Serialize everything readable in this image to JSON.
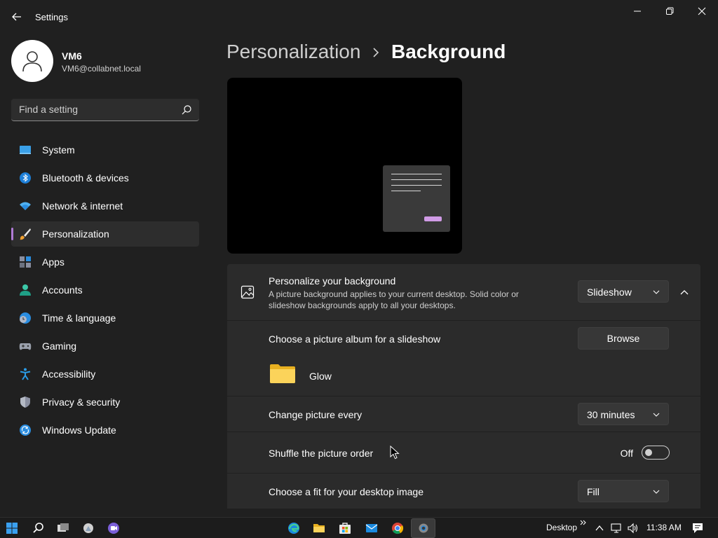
{
  "window": {
    "title": "Settings",
    "back_icon": "back-arrow-icon",
    "controls": [
      "minimize-icon",
      "restore-icon",
      "close-icon"
    ]
  },
  "profile": {
    "name": "VM6",
    "email": "VM6@collabnet.local"
  },
  "search": {
    "placeholder": "Find a setting"
  },
  "sidebar": {
    "items": [
      {
        "label": "System",
        "icon": "system-icon",
        "active": false
      },
      {
        "label": "Bluetooth & devices",
        "icon": "bluetooth-icon",
        "active": false
      },
      {
        "label": "Network & internet",
        "icon": "wifi-icon",
        "active": false
      },
      {
        "label": "Personalization",
        "icon": "brush-icon",
        "active": true
      },
      {
        "label": "Apps",
        "icon": "apps-icon",
        "active": false
      },
      {
        "label": "Accounts",
        "icon": "accounts-icon",
        "active": false
      },
      {
        "label": "Time & language",
        "icon": "clock-globe-icon",
        "active": false
      },
      {
        "label": "Gaming",
        "icon": "gamepad-icon",
        "active": false
      },
      {
        "label": "Accessibility",
        "icon": "accessibility-icon",
        "active": false
      },
      {
        "label": "Privacy & security",
        "icon": "shield-icon",
        "active": false
      },
      {
        "label": "Windows Update",
        "icon": "update-icon",
        "active": false
      }
    ]
  },
  "header": {
    "parent": "Personalization",
    "current": "Background"
  },
  "settings": {
    "personalize": {
      "title": "Personalize your background",
      "description": "A picture background applies to your current desktop. Solid color or slideshow backgrounds apply to all your desktops.",
      "value": "Slideshow"
    },
    "album": {
      "label": "Choose a picture album for a slideshow",
      "button": "Browse",
      "folder_name": "Glow"
    },
    "change": {
      "label": "Change picture every",
      "value": "30 minutes"
    },
    "shuffle": {
      "label": "Shuffle the picture order",
      "state": "Off"
    },
    "fit": {
      "label": "Choose a fit for your desktop image",
      "value": "Fill"
    }
  },
  "taskbar": {
    "desktop_label": "Desktop",
    "time": "11:38 AM"
  },
  "colors": {
    "accent": "#b07bd6",
    "background": "#202020",
    "card": "#2b2b2b"
  }
}
